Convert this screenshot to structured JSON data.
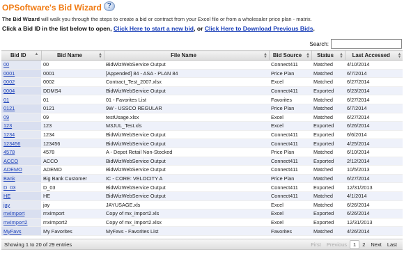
{
  "header": {
    "title": "OPSoftware's Bid Wizard",
    "help_icon": "question-mark-icon",
    "intro_bold": "The Bid Wizard",
    "intro_rest": " will walk you through the steps to create a bid or contract from your Excel file or from a wholesaler price plan - matrix.",
    "instr_prefix": "Click a Bid ID in the list below to open, ",
    "new_bid_link": "Click Here to start a new bid",
    "instr_middle": ", or ",
    "download_link": "Click Here to Download Previous Bids",
    "instr_suffix": "."
  },
  "search": {
    "label": "Search:",
    "value": ""
  },
  "table": {
    "columns": [
      "Bid ID",
      "Bid Name",
      "File Name",
      "Bid Source",
      "Status",
      "Last Accessed"
    ],
    "rows": [
      [
        "00",
        "00",
        "BidWizWebService Output",
        "Connect411",
        "Matched",
        "4/10/2014"
      ],
      [
        "0001",
        "0001",
        "[Appended] 84 - ASA - PLAN 84",
        "Price Plan",
        "Matched",
        "6/7/2014"
      ],
      [
        "0002",
        "0002",
        "Contract_Test_2007.xlsx",
        "Excel",
        "Matched",
        "6/27/2014"
      ],
      [
        "0004",
        "DDMS4",
        "BidWizWebService Output",
        "Connect411",
        "Exported",
        "6/23/2014"
      ],
      [
        "01",
        "01",
        "01 - Favorites List",
        "Favorites",
        "Matched",
        "6/27/2014"
      ],
      [
        "0121",
        "0121",
        "9W - USSCO REGULAR",
        "Price Plan",
        "Matched",
        "6/7/2014"
      ],
      [
        "09",
        "09",
        "testUsage.xlsx",
        "Excel",
        "Matched",
        "6/27/2014"
      ],
      [
        "123",
        "123",
        "M3JUL_Test.xls",
        "Excel",
        "Exported",
        "6/26/2014"
      ],
      [
        "1234",
        "1234",
        "BidWizWebService Output",
        "Connect411",
        "Exported",
        "6/6/2014"
      ],
      [
        "123456",
        "123456",
        "BidWizWebService Output",
        "Connect411",
        "Exported",
        "4/25/2014"
      ],
      [
        "4578",
        "4578",
        "A - Depot Retail Non-Stocked",
        "Price Plan",
        "Matched",
        "6/10/2014"
      ],
      [
        "ACCO",
        "ACCO",
        "BidWizWebService Output",
        "Connect411",
        "Exported",
        "2/12/2014"
      ],
      [
        "ADEMO",
        "ADEMO",
        "BidWizWebService Output",
        "Connect411",
        "Matched",
        "10/5/2013"
      ],
      [
        "Bank",
        "Big Bank Customer",
        "IC - CORE: VELOCITY A",
        "Price Plan",
        "Matched",
        "6/27/2014"
      ],
      [
        "D_03",
        "D_03",
        "BidWizWebService Output",
        "Connect411",
        "Exported",
        "12/31/2013"
      ],
      [
        "HE",
        "HE",
        "BidWizWebService Output",
        "Connect411",
        "Matched",
        "4/1/2014"
      ],
      [
        "jay",
        "jay",
        "JAYUSAGE.xls",
        "Excel",
        "Matched",
        "6/26/2014"
      ],
      [
        "mxImport",
        "mxImport",
        "Copy of mx_import2.xls",
        "Excel",
        "Exported",
        "6/26/2014"
      ],
      [
        "mxImport2",
        "mxImport2",
        "Copy of mx_import2.xlsx",
        "Excel",
        "Exported",
        "12/31/2013"
      ],
      [
        "MyFavs",
        "My Favorites",
        "MyFavs - Favorites List",
        "Favorites",
        "Matched",
        "4/26/2014"
      ]
    ]
  },
  "footer": {
    "info": "Showing 1 to 20 of 29 entries",
    "pager": {
      "first": "First",
      "previous": "Previous",
      "page1": "1",
      "page2": "2",
      "next": "Next",
      "last": "Last"
    }
  },
  "colors": {
    "title": "#f07a12",
    "link": "#1a3fb8",
    "row_alt": "#eef1fa"
  }
}
